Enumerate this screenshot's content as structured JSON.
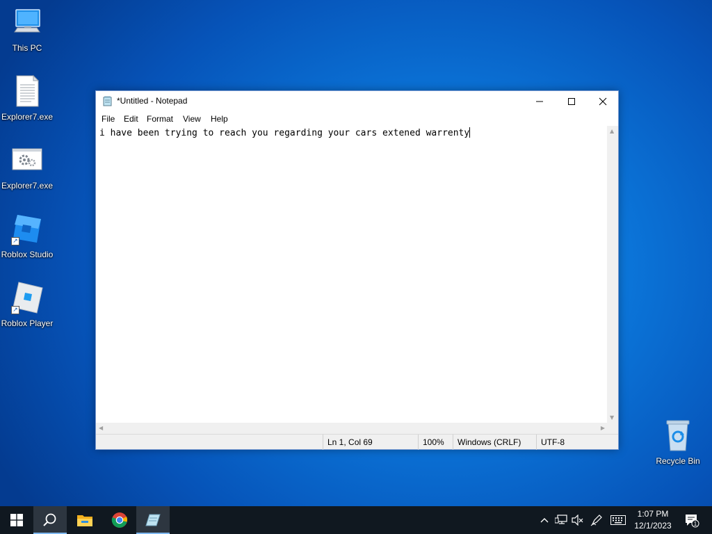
{
  "desktop": {
    "icons": [
      {
        "label": "This PC"
      },
      {
        "label": "Explorer7.exe"
      },
      {
        "label": "Explorer7.exe"
      },
      {
        "label": "Roblox Studio"
      },
      {
        "label": "Roblox Player"
      },
      {
        "label": "Recycle Bin"
      }
    ]
  },
  "notepad": {
    "title": "*Untitled - Notepad",
    "menu": [
      "File",
      "Edit",
      "Format",
      "View",
      "Help"
    ],
    "content": "i have been trying to reach you regarding your cars extened warrenty",
    "status": {
      "position": "Ln 1, Col 69",
      "zoom": "100%",
      "line_ending": "Windows (CRLF)",
      "encoding": "UTF-8"
    }
  },
  "taskbar": {
    "items": [
      "start-icon",
      "search-icon",
      "file-explorer-icon",
      "chrome-icon",
      "notepad-icon"
    ],
    "clock": {
      "time": "1:07 PM",
      "date": "12/1/2023"
    },
    "notification_count": "1"
  },
  "colors": {
    "desktop_accent": "#0b74d8",
    "taskbar": "#101820",
    "window_border": "#7a9ad0"
  }
}
